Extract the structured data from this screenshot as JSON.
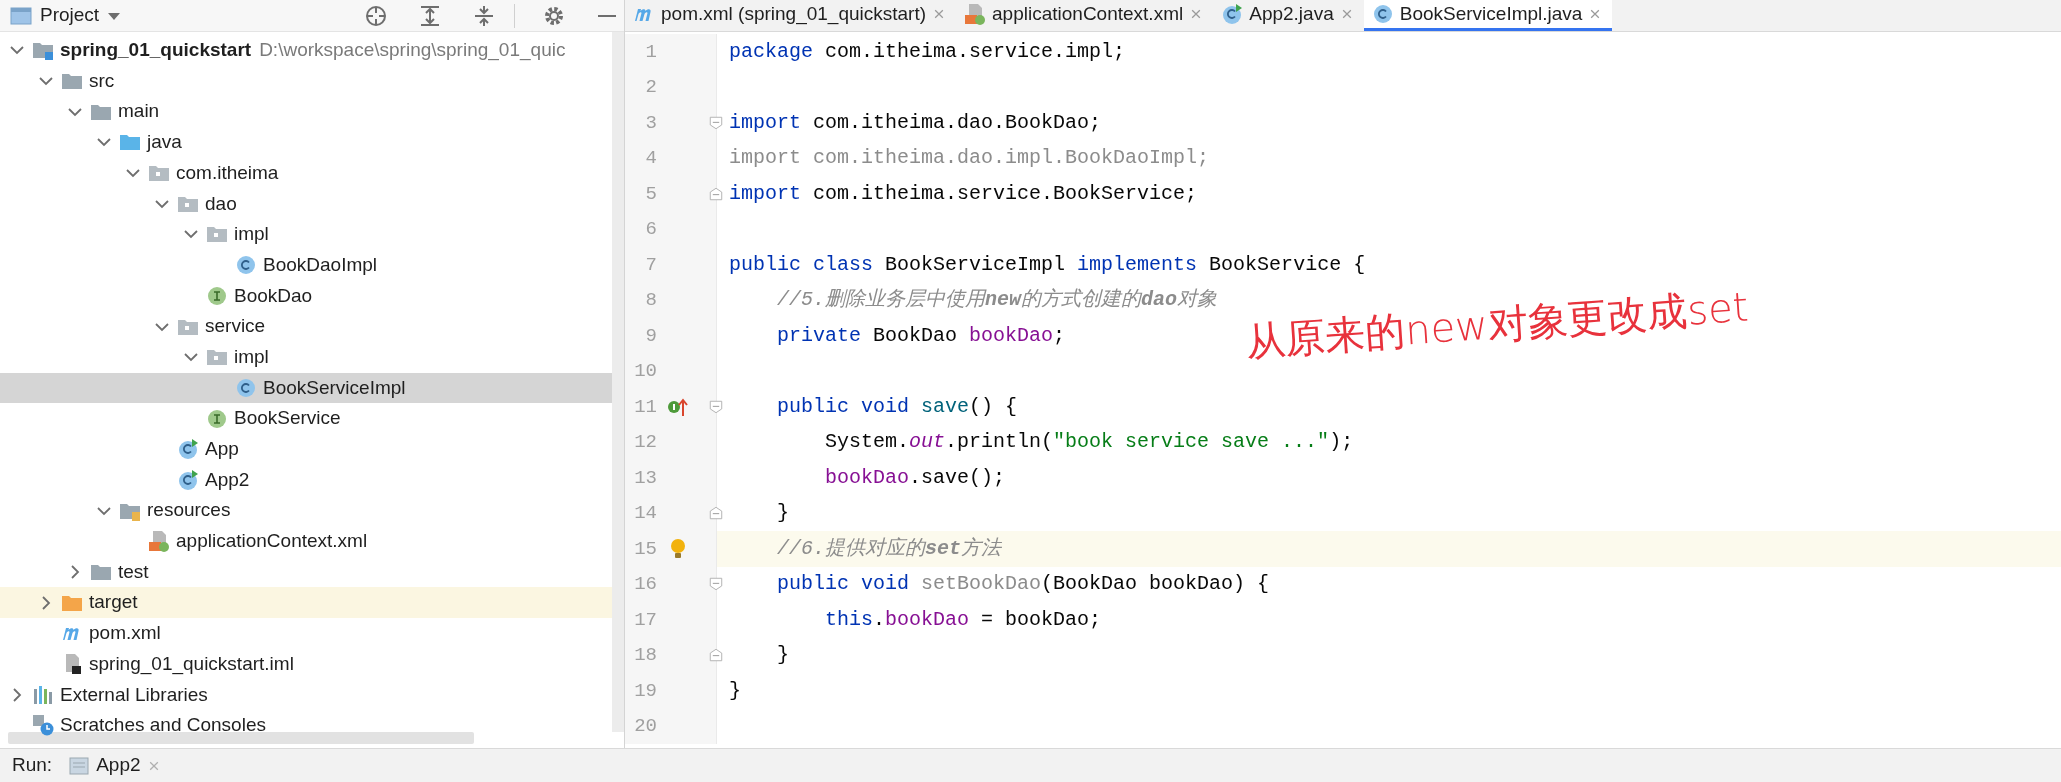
{
  "project_panel": {
    "title": "Project",
    "tree": [
      {
        "name": "spring_01_quickstart",
        "hint": "D:\\workspace\\spring\\spring_01_quic",
        "kind": "module",
        "expanded": true,
        "selected": false,
        "children": [
          {
            "name": "src",
            "kind": "folder",
            "expanded": true,
            "selected": false,
            "children": [
              {
                "name": "main",
                "kind": "folder",
                "expanded": true,
                "selected": false,
                "children": [
                  {
                    "name": "java",
                    "kind": "source-folder",
                    "expanded": true,
                    "selected": false,
                    "children": [
                      {
                        "name": "com.itheima",
                        "kind": "package",
                        "expanded": true,
                        "selected": false,
                        "children": [
                          {
                            "name": "dao",
                            "kind": "package",
                            "expanded": true,
                            "selected": false,
                            "children": [
                              {
                                "name": "impl",
                                "kind": "package",
                                "expanded": true,
                                "selected": false,
                                "children": [
                                  {
                                    "name": "BookDaoImpl",
                                    "kind": "class",
                                    "selected": false
                                  }
                                ]
                              },
                              {
                                "name": "BookDao",
                                "kind": "interface",
                                "selected": false
                              }
                            ]
                          },
                          {
                            "name": "service",
                            "kind": "package",
                            "expanded": true,
                            "selected": false,
                            "children": [
                              {
                                "name": "impl",
                                "kind": "package",
                                "expanded": true,
                                "selected": false,
                                "children": [
                                  {
                                    "name": "BookServiceImpl",
                                    "kind": "class",
                                    "selected": true
                                  }
                                ]
                              },
                              {
                                "name": "BookService",
                                "kind": "interface",
                                "selected": false
                              }
                            ]
                          },
                          {
                            "name": "App",
                            "kind": "main-class",
                            "selected": false
                          },
                          {
                            "name": "App2",
                            "kind": "main-class",
                            "selected": false
                          }
                        ]
                      }
                    ]
                  },
                  {
                    "name": "resources",
                    "kind": "resource-folder",
                    "expanded": true,
                    "selected": false,
                    "children": [
                      {
                        "name": "applicationContext.xml",
                        "kind": "xml",
                        "selected": false
                      }
                    ]
                  }
                ]
              },
              {
                "name": "test",
                "kind": "folder",
                "expanded": false,
                "selected": false
              }
            ]
          },
          {
            "name": "target",
            "kind": "excluded-folder",
            "expanded": false,
            "selected": false,
            "highlighted": true
          },
          {
            "name": "pom.xml",
            "kind": "maven",
            "selected": false
          },
          {
            "name": "spring_01_quickstart.iml",
            "kind": "iml",
            "selected": false
          }
        ]
      },
      {
        "name": "External Libraries",
        "kind": "libraries",
        "expanded": false,
        "selected": false
      },
      {
        "name": "Scratches and Consoles",
        "kind": "scratches",
        "selected": false
      }
    ]
  },
  "tabs": [
    {
      "label": "pom.xml (spring_01_quickstart)",
      "kind": "maven",
      "selected": false
    },
    {
      "label": "applicationContext.xml",
      "kind": "xml",
      "selected": false
    },
    {
      "label": "App2.java",
      "kind": "main-class",
      "selected": false
    },
    {
      "label": "BookServiceImpl.java",
      "kind": "class",
      "selected": true
    }
  ],
  "editor": {
    "lines": [
      {
        "number": "1",
        "tokens": [
          {
            "kind": "kw",
            "text": "package"
          },
          {
            "kind": "plain",
            "text": " com.itheima.service.impl;"
          }
        ]
      },
      {
        "number": "2"
      },
      {
        "number": "3",
        "fold_start": true,
        "tokens": [
          {
            "kind": "kw",
            "text": "import"
          },
          {
            "kind": "plain",
            "text": " com.itheima.dao.BookDao;"
          }
        ]
      },
      {
        "number": "4",
        "tokens": [
          {
            "kind": "unused",
            "text": "import com.itheima.dao.impl.BookDaoImpl;"
          }
        ]
      },
      {
        "number": "5",
        "fold_end": true,
        "tokens": [
          {
            "kind": "kw",
            "text": "import"
          },
          {
            "kind": "plain",
            "text": " com.itheima.service.BookService;"
          }
        ]
      },
      {
        "number": "6"
      },
      {
        "number": "7",
        "tokens": [
          {
            "kind": "kw",
            "text": "public class"
          },
          {
            "kind": "plain",
            "text": " BookServiceImpl "
          },
          {
            "kind": "kw",
            "text": "implements"
          },
          {
            "kind": "plain",
            "text": " BookService {"
          }
        ]
      },
      {
        "number": "8",
        "tokens": [
          {
            "kind": "comment",
            "text": "    //5.删除业务层中使用**new**的方式创建的**dao**对象"
          }
        ]
      },
      {
        "number": "9",
        "tokens": [
          {
            "kind": "kw",
            "text": "    private"
          },
          {
            "kind": "plain",
            "text": " BookDao "
          },
          {
            "kind": "field",
            "text": "bookDao"
          },
          {
            "kind": "plain",
            "text": ";"
          }
        ]
      },
      {
        "number": "10"
      },
      {
        "number": "11",
        "implements_marker": true,
        "fold_start": true,
        "tokens": [
          {
            "kind": "kw",
            "text": "    public void"
          },
          {
            "kind": "method",
            "text": " save"
          },
          {
            "kind": "plain",
            "text": "() {"
          }
        ]
      },
      {
        "number": "12",
        "tokens": [
          {
            "kind": "plain",
            "text": "        System."
          },
          {
            "kind": "static",
            "text": "out"
          },
          {
            "kind": "plain",
            "text": ".println("
          },
          {
            "kind": "string",
            "text": "\"book service save ...\""
          },
          {
            "kind": "plain",
            "text": ");"
          }
        ]
      },
      {
        "number": "13",
        "tokens": [
          {
            "kind": "field",
            "text": "        bookDao"
          },
          {
            "kind": "plain",
            "text": ".save();"
          }
        ]
      },
      {
        "number": "14",
        "fold_end": true,
        "tokens": [
          {
            "kind": "plain",
            "text": "    }"
          }
        ]
      },
      {
        "number": "15",
        "bulb": true,
        "current": true,
        "tokens": [
          {
            "kind": "comment",
            "text": "    //6.提供对应的**set**方法"
          }
        ]
      },
      {
        "number": "16",
        "fold_start": true,
        "tokens": [
          {
            "kind": "kw",
            "text": "    public void"
          },
          {
            "kind": "unused",
            "text": " setBookDao"
          },
          {
            "kind": "plain",
            "text": "(BookDao bookDao) {"
          }
        ]
      },
      {
        "number": "17",
        "tokens": [
          {
            "kind": "kw",
            "text": "        this"
          },
          {
            "kind": "plain",
            "text": "."
          },
          {
            "kind": "field",
            "text": "bookDao"
          },
          {
            "kind": "plain",
            "text": " = bookDao;"
          }
        ]
      },
      {
        "number": "18",
        "fold_end": true,
        "tokens": [
          {
            "kind": "plain",
            "text": "    }"
          }
        ]
      },
      {
        "number": "19",
        "tokens": [
          {
            "kind": "plain",
            "text": "}"
          }
        ]
      },
      {
        "number": "20"
      }
    ],
    "annotation": "从原来的new对象更改成set"
  },
  "run_bar": {
    "label": "Run:",
    "tab": "App2"
  }
}
